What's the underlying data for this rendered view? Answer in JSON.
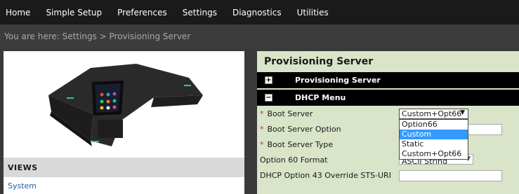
{
  "nav": {
    "items": [
      "Home",
      "Simple Setup",
      "Preferences",
      "Settings",
      "Diagnostics",
      "Utilities"
    ]
  },
  "breadcrumb": "You are here: Settings > Provisioning Server",
  "left": {
    "views_header": "VIEWS",
    "views_items": [
      "System"
    ]
  },
  "panel": {
    "title": "Provisioning Server",
    "sections": [
      {
        "label": "Provisioning Server",
        "toggle": "+"
      },
      {
        "label": "DHCP Menu",
        "toggle": "−"
      }
    ],
    "fields": {
      "boot_server": {
        "label": "Boot Server",
        "required": "*",
        "value": "Custom+Opt66"
      },
      "boot_server_option": {
        "label": "Boot Server Option",
        "required": "*"
      },
      "boot_server_type": {
        "label": "Boot Server Type",
        "required": "*"
      },
      "option60": {
        "label": "Option 60 Format",
        "value": "ASCII String"
      },
      "option43": {
        "label": "DHCP Option 43 Override STS-URI"
      }
    },
    "dropdown_options": [
      "Option66",
      "Custom",
      "Static",
      "Custom+Opt66"
    ],
    "dropdown_selected": "Custom"
  },
  "colors": {
    "nav_bg": "#1a1a1a",
    "panel_bg": "#d9e4c9",
    "section_bg": "#000000",
    "link": "#1f5f9e",
    "highlight": "#3399ff",
    "required": "#c0392b"
  },
  "icons": {
    "expand": "plus-icon",
    "collapse": "minus-icon",
    "dropdown": "caret-down-icon"
  }
}
